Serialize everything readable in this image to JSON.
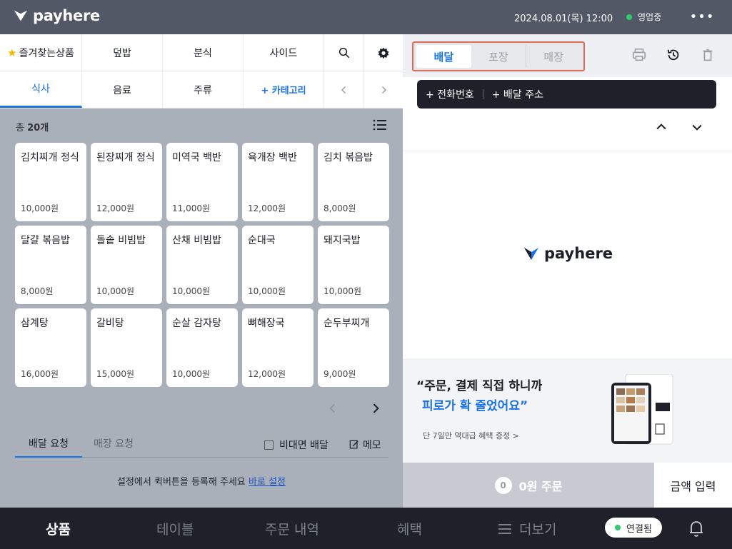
{
  "header": {
    "brand": "payhere",
    "datetime": "2024.08.01(목) 12:00",
    "status": "영업중"
  },
  "categories": {
    "row1": [
      {
        "label": "즐겨찾는상품",
        "icon": "star-icon"
      },
      {
        "label": "덮밥"
      },
      {
        "label": "분식"
      },
      {
        "label": "사이드"
      }
    ],
    "row2": [
      {
        "label": "식사",
        "active": true
      },
      {
        "label": "음료"
      },
      {
        "label": "주류"
      },
      {
        "label": "+ 카테고리"
      }
    ]
  },
  "product_count": {
    "prefix": "총",
    "count": "20개"
  },
  "products": [
    {
      "name": "김치찌개 정식",
      "price": "10,000원"
    },
    {
      "name": "된장찌개 정식",
      "price": "12,000원"
    },
    {
      "name": "미역국 백반",
      "price": "11,000원"
    },
    {
      "name": "육개장 백반",
      "price": "12,000원"
    },
    {
      "name": "김치 볶음밥",
      "price": "8,000원"
    },
    {
      "name": "달걀 볶음밥",
      "price": "8,000원"
    },
    {
      "name": "돌솥 비빔밥",
      "price": "10,000원"
    },
    {
      "name": "산채 비빔밥",
      "price": "10,000원"
    },
    {
      "name": "순대국",
      "price": "10,000원"
    },
    {
      "name": "돼지국밥",
      "price": "10,000원"
    },
    {
      "name": "삼계탕",
      "price": "16,000원"
    },
    {
      "name": "갈비탕",
      "price": "15,000원"
    },
    {
      "name": "순살 감자탕",
      "price": "10,000원"
    },
    {
      "name": "뼈해장국",
      "price": "12,000원"
    },
    {
      "name": "순두부찌개",
      "price": "9,000원"
    }
  ],
  "request": {
    "tab_active": "배달 요청",
    "tab_inactive": "매장 요청",
    "contactless": "비대면 배달",
    "memo": "메모",
    "note": "설정에서 퀵버튼을 등록해 주세요",
    "note_link": "바로 설정"
  },
  "order": {
    "types": [
      "배달",
      "포장",
      "매장"
    ],
    "phone": "+ 전화번호",
    "address": "+ 배달 주소",
    "center_brand": "payhere",
    "promo_line1": "“주문, 결제 직접 하니까",
    "promo_line2": "피로가 확 줄었어요”",
    "promo_sub": "단 7일만 역대급 혜택 증정 >",
    "count": "0",
    "order_label": "0원 주문",
    "amount_label": "금액 입력"
  },
  "bottom_nav": {
    "products": "상품",
    "table": "테이블",
    "history": "주문 내역",
    "benefits": "혜택",
    "more": "더보기",
    "connection": "연결됨"
  },
  "colors": {
    "accent": "#1a73e8",
    "topbar": "#525866",
    "highlight_border": "#e06b58",
    "status_green": "#2ecc71"
  }
}
